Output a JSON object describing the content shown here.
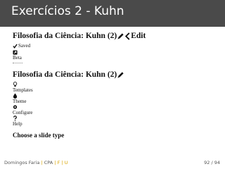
{
  "header": {
    "title": "Exercícios 2 - Kuhn"
  },
  "section1": {
    "title": "Filosofia da Ciência: Kuhn (2)",
    "edit_label": "Edit",
    "saved_label": "Saved",
    "beta_label": "Beta"
  },
  "section2": {
    "title": "Filosofia da Ciência: Kuhn (2)",
    "items": [
      {
        "label": "Templates",
        "icon": "lightbulb-icon"
      },
      {
        "label": "Theme",
        "icon": "drop-icon"
      },
      {
        "label": "Configure",
        "icon": "gear-icon"
      },
      {
        "label": "Help",
        "icon": "question-icon"
      }
    ]
  },
  "choose_label": "Choose a slide type",
  "footer": {
    "author": "Domingos Faria",
    "org": "CPA",
    "sep1": "|",
    "part_a": "F",
    "sep2": "|",
    "part_b": "U",
    "page": "92 / 94"
  },
  "colors": {
    "header_bg": "#4a4a4a",
    "accent": "#d9a400"
  }
}
